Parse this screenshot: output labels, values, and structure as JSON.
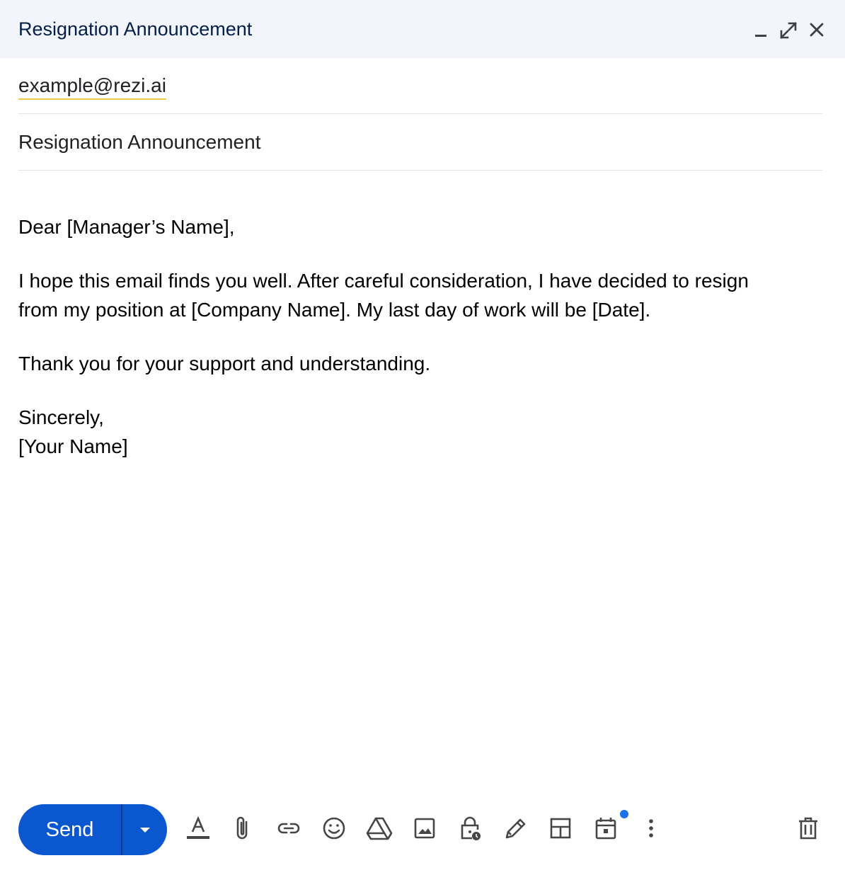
{
  "window": {
    "title": "Resignation Announcement",
    "controls": [
      "minimize-icon",
      "expand-icon",
      "close-icon"
    ]
  },
  "compose": {
    "to": "example@rezi.ai",
    "subject": "Resignation Announcement",
    "body": {
      "greeting": "Dear [Manager’s Name],",
      "paragraph1_line1": "I hope this email finds you well. After careful consideration, I have decided to resign",
      "paragraph1_line2": "from my position at [Company Name]. My last day of work will be [Date].",
      "paragraph2": "Thank you for your support and understanding.",
      "closing": "Sincerely,",
      "signature": "[Your Name]"
    }
  },
  "toolbar": {
    "send_label": "Send",
    "icons": [
      "formatting-icon",
      "attach-icon",
      "link-icon",
      "emoji-icon",
      "drive-icon",
      "photo-icon",
      "confidential-icon",
      "signature-icon",
      "layout-icon",
      "schedule-icon",
      "more-options-icon",
      "delete-icon"
    ],
    "colors": {
      "send": "#0b57d0",
      "notification_dot": "#1a73e8"
    }
  }
}
